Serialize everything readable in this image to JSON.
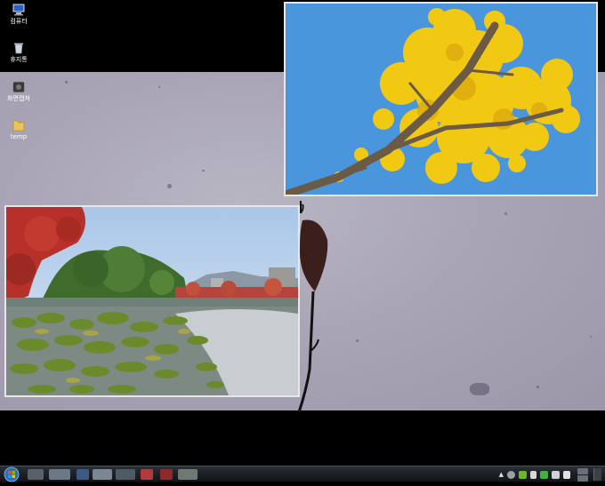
{
  "desktop": {
    "icons": [
      {
        "label": "컴퓨터",
        "icon": "computer-icon"
      },
      {
        "label": "휴지통",
        "icon": "recycle-bin-icon"
      },
      {
        "label": "화면캡쳐",
        "icon": "camera-app-icon"
      },
      {
        "label": "temp",
        "icon": "folder-icon"
      }
    ]
  },
  "windows": [
    {
      "name": "ginkgo-photo",
      "icon": "photo"
    },
    {
      "name": "lotus-pond-photo",
      "icon": "photo"
    }
  ],
  "colors": {
    "taskbar": "#15181d",
    "sky": "#4a96dc",
    "ginkgo_yellow": "#f2c912",
    "wallpaper": "#aeaabb"
  }
}
